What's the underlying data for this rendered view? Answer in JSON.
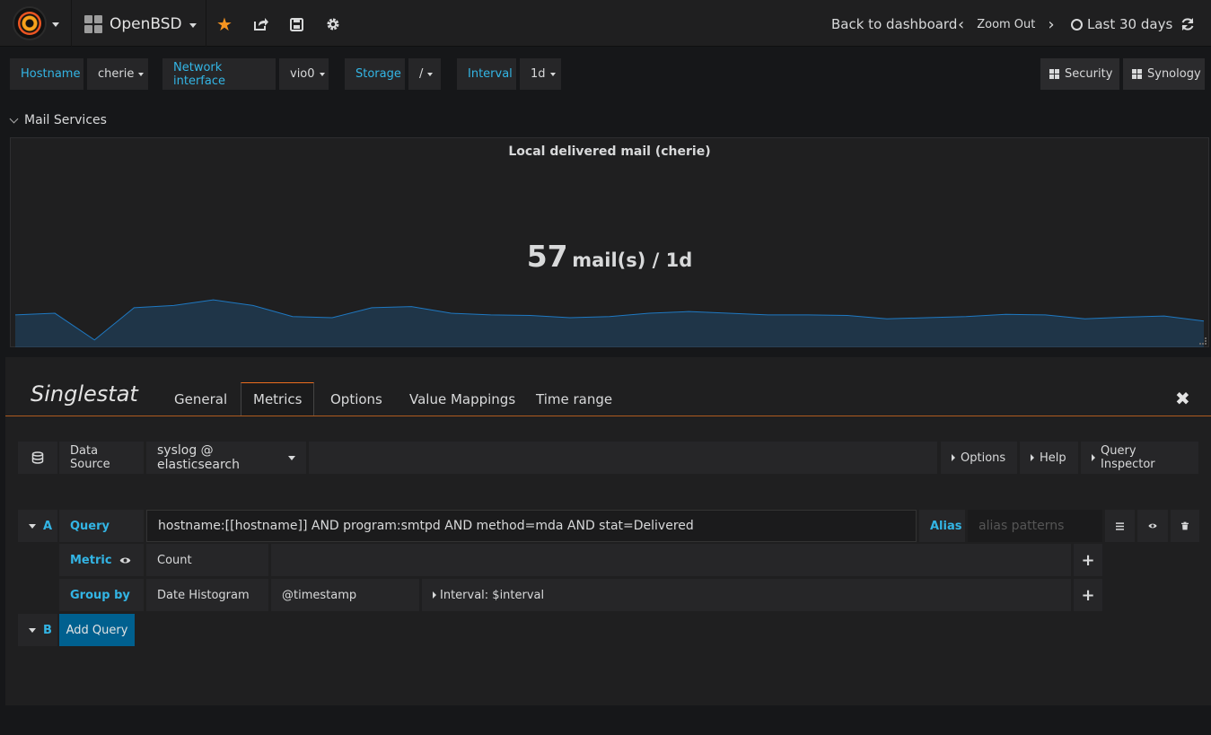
{
  "navbar": {
    "dashboard_title": "OpenBSD",
    "back_label": "Back to dashboard",
    "zoom_label": "Zoom Out",
    "time_range": "Last 30 days"
  },
  "variables": [
    {
      "label": "Hostname",
      "value": "cherie"
    },
    {
      "label": "Network interface",
      "value": "vio0"
    },
    {
      "label": "Storage",
      "value": "/"
    },
    {
      "label": "Interval",
      "value": "1d"
    }
  ],
  "links": [
    {
      "label": "Security"
    },
    {
      "label": "Synology"
    }
  ],
  "row": {
    "title": "Mail Services"
  },
  "panel": {
    "title": "Local delivered mail (cherie)",
    "value": "57",
    "unit": "mail(s) / 1d",
    "sparkline_color": "#1f78c1"
  },
  "chart_data": {
    "type": "area",
    "values": [
      55,
      58,
      10,
      68,
      72,
      82,
      72,
      52,
      50,
      68,
      70,
      58,
      55,
      54,
      50,
      52,
      58,
      61,
      58,
      55,
      55,
      54,
      48,
      50,
      52,
      56,
      55,
      48,
      51,
      53,
      44
    ]
  },
  "editor": {
    "title": "Singlestat",
    "tabs": [
      "General",
      "Metrics",
      "Options",
      "Value Mappings",
      "Time range"
    ],
    "active_tab": "Metrics",
    "data_source_label": "Data Source",
    "data_source_value": "syslog @ elasticsearch",
    "options_label": "Options",
    "help_label": "Help",
    "query_inspector_label": "Query Inspector",
    "query_a": {
      "ref": "A",
      "query_label": "Query",
      "query_value": "hostname:[[hostname]] AND program:smtpd AND method=mda AND stat=Delivered",
      "alias_label": "Alias",
      "alias_placeholder": "alias patterns",
      "metric_label": "Metric",
      "metric_value": "Count",
      "group_by_label": "Group by",
      "group_by_type": "Date Histogram",
      "group_by_field": "@timestamp",
      "group_by_interval": "Interval: $interval"
    },
    "query_b": {
      "ref": "B",
      "add_label": "Add Query"
    }
  }
}
